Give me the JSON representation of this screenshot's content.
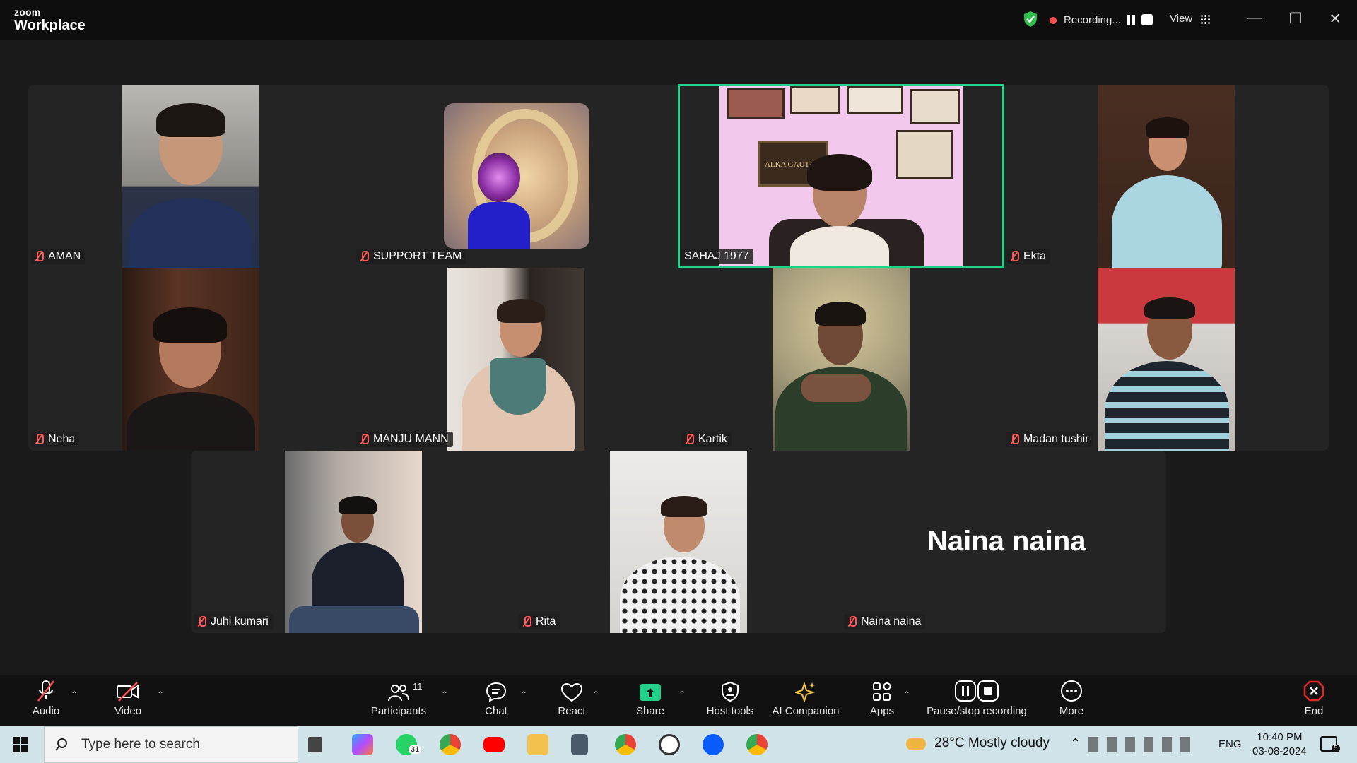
{
  "app": {
    "brand_small": "zoom",
    "brand_big": "Workplace"
  },
  "titlebar": {
    "recording_label": "Recording...",
    "view_label": "View",
    "minimize": "—",
    "restore": "❐",
    "close": "✕"
  },
  "participants": {
    "aman": "AMAN",
    "support": "SUPPORT TEAM",
    "sahaj": "SAHAJ 1977",
    "ekta": "Ekta",
    "neha": "Neha",
    "manju": "MANJU MANN",
    "kartik": "Kartik",
    "madan": "Madan tushir",
    "juhi": "Juhi kumari",
    "rita": "Rita",
    "naina": "Naina naina",
    "naina_big": "Naina naina"
  },
  "video_text": {
    "certificate": "ALKA GAUTAM"
  },
  "toolbar": {
    "audio": "Audio",
    "video": "Video",
    "participants": "Participants",
    "participants_count": "11",
    "chat": "Chat",
    "react": "React",
    "share": "Share",
    "host_tools": "Host tools",
    "ai_companion": "AI Companion",
    "apps": "Apps",
    "pause_stop": "Pause/stop recording",
    "more": "More",
    "end": "End"
  },
  "taskbar": {
    "search_placeholder": "Type here to search",
    "whatsapp_badge": "31",
    "weather": "28°C  Mostly cloudy",
    "lang": "ENG",
    "time": "10:40 PM",
    "date": "03-08-2024",
    "notif_count": "5"
  },
  "colors": {
    "active_speaker": "#23d18b",
    "muted": "#ff5a5a",
    "share_green": "#23d18b",
    "end_red": "#e02828"
  }
}
